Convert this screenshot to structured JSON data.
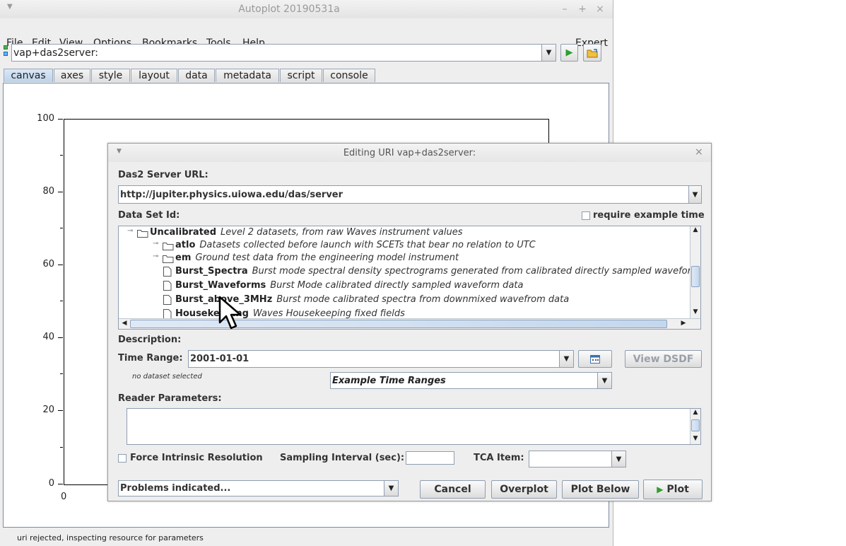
{
  "window": {
    "title": "Autoplot 20190531a"
  },
  "menu": [
    "File",
    "Edit",
    "View",
    "Options",
    "Bookmarks",
    "Tools",
    "Help"
  ],
  "menu_right": "Expert",
  "uri_field": {
    "value": "vap+das2server:"
  },
  "tabs": [
    "canvas",
    "axes",
    "style",
    "layout",
    "data",
    "metadata",
    "script",
    "console"
  ],
  "active_tab": "canvas",
  "plot": {
    "yticks": [
      "100",
      "80",
      "60",
      "40",
      "20",
      "0"
    ],
    "xticks": [
      "0"
    ]
  },
  "status": "uri rejected, inspecting resource for parameters",
  "dialog": {
    "title": "Editing URI vap+das2server:",
    "server_url_label": "Das2 Server URL:",
    "server_url": "http://jupiter.physics.uiowa.edu/das/server",
    "dataset_label": "Data Set Id:",
    "require_example_time": "require example time",
    "tree": [
      {
        "type": "folder",
        "name": "Uncalibrated",
        "desc": "Level 2 datasets, from raw Waves instrument values"
      },
      {
        "type": "folder",
        "name": "atlo",
        "desc": "Datasets collected before launch with SCETs that bear no relation to UTC"
      },
      {
        "type": "folder",
        "name": "em",
        "desc": "Ground test data from the engineering model instrument"
      },
      {
        "type": "file",
        "name": "Burst_Spectra",
        "desc": "Burst mode spectral density spectrograms generated from calibrated directly sampled waveform da"
      },
      {
        "type": "file",
        "name": "Burst_Waveforms",
        "desc": "Burst Mode calibrated directly sampled waveform data"
      },
      {
        "type": "file",
        "name": "Burst_above_3MHz",
        "desc": "Burst mode calibrated spectra from downmixed wavefrom data"
      },
      {
        "type": "file",
        "name": "Housekeeping",
        "desc": "Waves Housekeeping fixed fields"
      }
    ],
    "description_label": "Description:",
    "time_range_label": "Time Range:",
    "time_range": "2001-01-01",
    "view_dsdf": "View DSDF",
    "no_dataset": "no dataset selected",
    "example_time_ranges": "Example Time Ranges",
    "reader_params_label": "Reader Parameters:",
    "force_intrinsic": "Force Intrinsic Resolution",
    "sampling_interval_label": "Sampling Interval (sec):",
    "tca_item_label": "TCA Item:",
    "problems": "Problems indicated...",
    "buttons": {
      "cancel": "Cancel",
      "overplot": "Overplot",
      "plot_below": "Plot Below",
      "plot": "Plot"
    }
  }
}
